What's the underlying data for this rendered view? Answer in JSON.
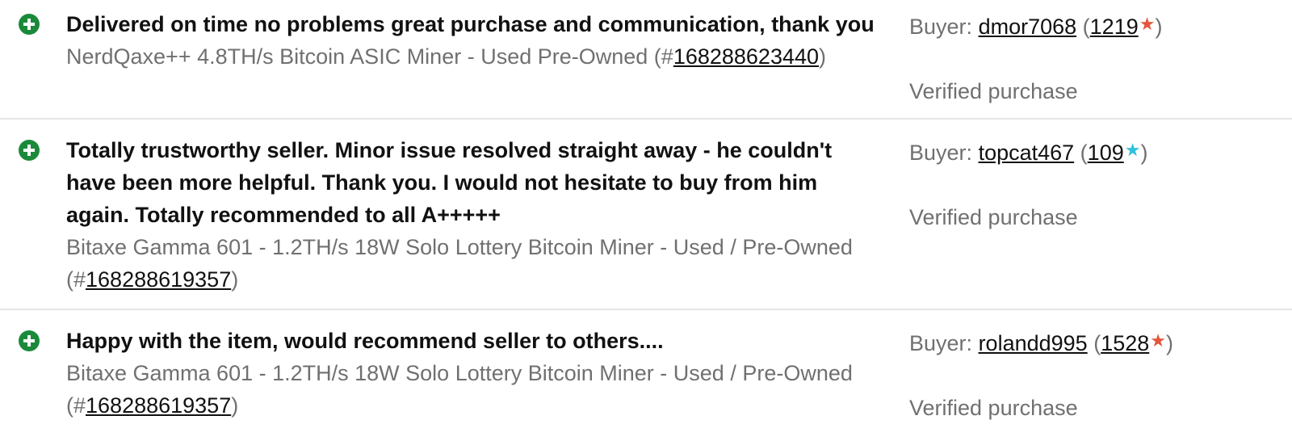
{
  "feedback": [
    {
      "comment": "Delivered on time no problems great purchase and communication, thank you",
      "item_title": "NerdQaxe++ 4.8TH/s Bitcoin ASIC Miner - Used Pre-Owned",
      "item_number": "168288623440",
      "buyer_prefix": "Buyer:",
      "buyer_name": "dmor7068",
      "buyer_score": "1219",
      "star_color": "#e4553b",
      "verified_label": "Verified purchase"
    },
    {
      "comment": "Totally trustworthy seller. Minor issue resolved straight away - he couldn't have been more helpful. Thank you. I would not hesitate to buy from him again. Totally recommended to all A+++++",
      "item_title": "Bitaxe Gamma 601 - 1.2TH/s 18W Solo Lottery Bitcoin Miner - Used / Pre-Owned",
      "item_number": "168288619357",
      "buyer_prefix": "Buyer:",
      "buyer_name": "topcat467",
      "buyer_score": "109",
      "star_color": "#2fc0dd",
      "verified_label": "Verified purchase"
    },
    {
      "comment": "Happy with the item, would recommend seller to others....",
      "item_title": "Bitaxe Gamma 601 - 1.2TH/s 18W Solo Lottery Bitcoin Miner - Used / Pre-Owned",
      "item_number": "168288619357",
      "buyer_prefix": "Buyer:",
      "buyer_name": "rolandd995",
      "buyer_score": "1528",
      "star_color": "#e4553b",
      "verified_label": "Verified purchase"
    }
  ],
  "icons": {
    "rating": "positive-plus-icon",
    "star": "feedback-star-icon"
  },
  "colors": {
    "positive_green": "#1a8a3a",
    "muted_text": "#707070",
    "divider": "#e5e5e5"
  }
}
